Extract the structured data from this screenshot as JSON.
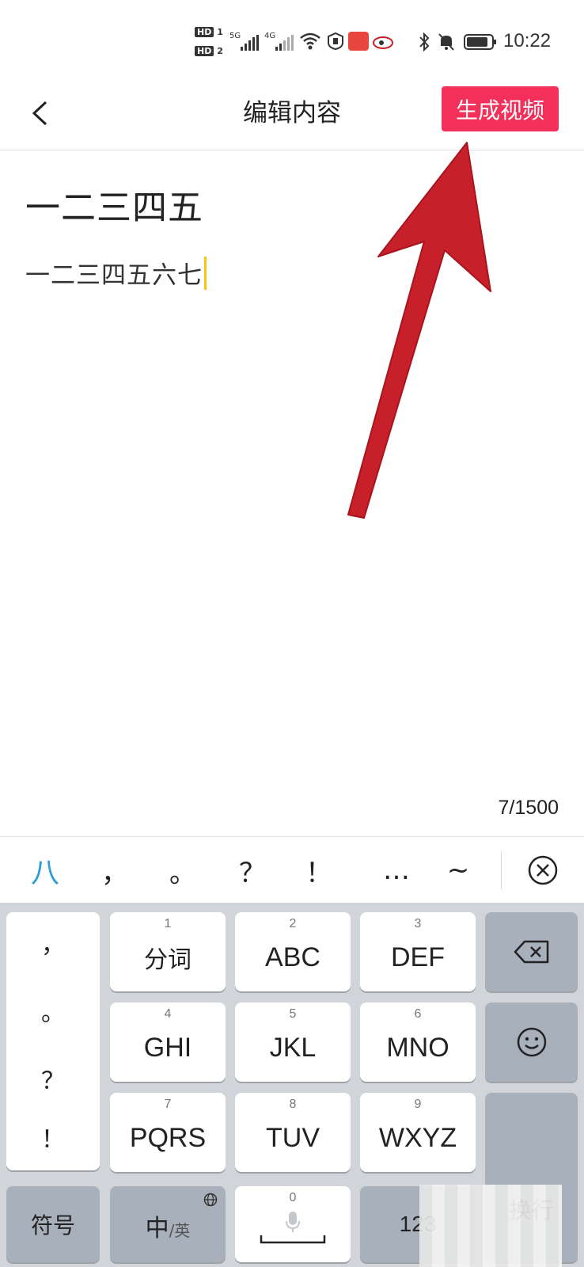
{
  "status_bar": {
    "hd1": "HD",
    "hd1_num": "1",
    "hd2": "HD",
    "hd2_num": "2",
    "sig1": "5G",
    "sig2": "4G",
    "time": "10:22"
  },
  "header": {
    "title": "编辑内容",
    "generate_label": "生成视频"
  },
  "editor": {
    "title": "一二三四五",
    "body": "一二三四五六七",
    "char_count": "7/1500"
  },
  "candidates": [
    "八",
    "，",
    "。",
    "？",
    "！",
    "…",
    "~"
  ],
  "keyboard": {
    "punct": [
      "，",
      "。",
      "？",
      "！"
    ],
    "keys": [
      {
        "num": "1",
        "label": "分词"
      },
      {
        "num": "2",
        "label": "ABC"
      },
      {
        "num": "3",
        "label": "DEF"
      },
      {
        "num": "4",
        "label": "GHI"
      },
      {
        "num": "5",
        "label": "JKL"
      },
      {
        "num": "6",
        "label": "MNO"
      },
      {
        "num": "7",
        "label": "PQRS"
      },
      {
        "num": "8",
        "label": "TUV"
      },
      {
        "num": "9",
        "label": "WXYZ"
      }
    ],
    "enter_label": "换行",
    "symbol_label": "符号",
    "lang_label": "中",
    "lang_alt": "/英",
    "space_num": "0",
    "num_label": "123"
  },
  "colors": {
    "accent": "#f3305a",
    "arrow": "#c8202b",
    "candidate_highlight": "#2a9fd6",
    "cursor": "#f5c518"
  }
}
